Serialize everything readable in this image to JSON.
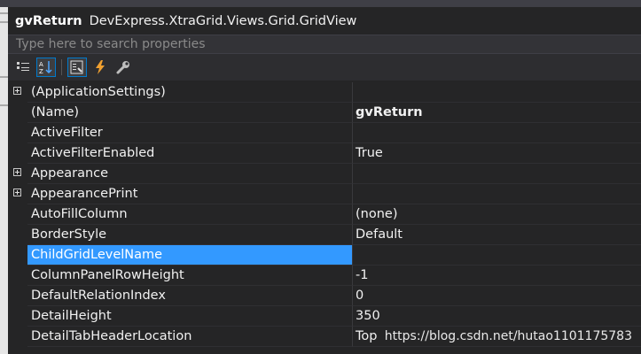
{
  "header": {
    "object_name": "gvReturn",
    "object_type": "DevExpress.XtraGrid.Views.Grid.GridView"
  },
  "search": {
    "placeholder": "Type here to search properties"
  },
  "toolbar": {
    "buttons": [
      {
        "icon": "categorized-icon",
        "active": false
      },
      {
        "icon": "alphabetical-icon",
        "active": true
      },
      {
        "icon": "properties-icon",
        "active": true
      },
      {
        "icon": "events-lightning-icon",
        "active": false
      },
      {
        "icon": "property-pages-wrench-icon",
        "active": false
      }
    ]
  },
  "properties": [
    {
      "name": "(ApplicationSettings)",
      "value": "",
      "expandable": true
    },
    {
      "name": "(Name)",
      "value": "gvReturn",
      "bold": true
    },
    {
      "name": "ActiveFilter",
      "value": ""
    },
    {
      "name": "ActiveFilterEnabled",
      "value": "True"
    },
    {
      "name": "Appearance",
      "value": "",
      "expandable": true
    },
    {
      "name": "AppearancePrint",
      "value": "",
      "expandable": true
    },
    {
      "name": "AutoFillColumn",
      "value": "(none)"
    },
    {
      "name": "BorderStyle",
      "value": "Default"
    },
    {
      "name": "ChildGridLevelName",
      "value": "",
      "selected": true
    },
    {
      "name": "ColumnPanelRowHeight",
      "value": "-1"
    },
    {
      "name": "DefaultRelationIndex",
      "value": "0"
    },
    {
      "name": "DetailHeight",
      "value": "350"
    },
    {
      "name": "DetailTabHeaderLocation",
      "value": "Top"
    }
  ],
  "watermark": "https://blog.csdn.net/hutao1101175783",
  "colors": {
    "background": "#252526",
    "selection": "#3399ff",
    "toolbar_active_border": "#007acc"
  }
}
